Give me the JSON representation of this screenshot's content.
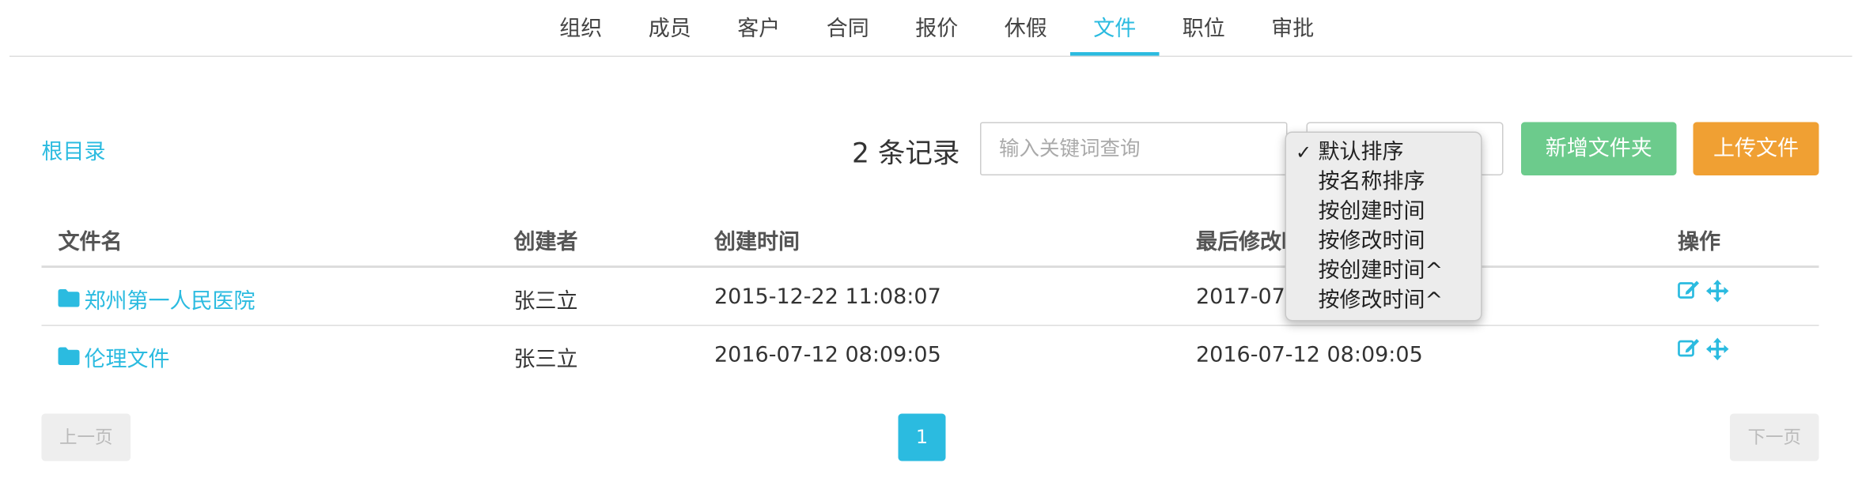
{
  "tabs": [
    {
      "label": "组织",
      "active": false
    },
    {
      "label": "成员",
      "active": false
    },
    {
      "label": "客户",
      "active": false
    },
    {
      "label": "合同",
      "active": false
    },
    {
      "label": "报价",
      "active": false
    },
    {
      "label": "休假",
      "active": false
    },
    {
      "label": "文件",
      "active": true
    },
    {
      "label": "职位",
      "active": false
    },
    {
      "label": "审批",
      "active": false
    }
  ],
  "breadcrumb": {
    "root_label": "根目录"
  },
  "records": {
    "count": "2",
    "suffix": "条记录"
  },
  "search": {
    "placeholder": "输入关键词查询",
    "value": ""
  },
  "sort": {
    "selected": "默认排序",
    "options": [
      "默认排序",
      "按名称排序",
      "按创建时间",
      "按修改时间",
      "按创建时间^",
      "按修改时间^"
    ],
    "check_glyph": "✓"
  },
  "buttons": {
    "new_folder": "新增文件夹",
    "upload": "上传文件"
  },
  "table": {
    "headers": [
      "文件名",
      "创建者",
      "创建时间",
      "最后修改时间",
      "操作"
    ],
    "rows": [
      {
        "name": "郑州第一人民医院",
        "creator": "张三立",
        "created": "2015-12-22 11:08:07",
        "modified": "2017-07-"
      },
      {
        "name": "伦理文件",
        "creator": "张三立",
        "created": "2016-07-12 08:09:05",
        "modified": "2016-07-12 08:09:05"
      }
    ]
  },
  "pagination": {
    "prev": "上一页",
    "next": "下一页",
    "current": "1"
  },
  "icons": {
    "row": [
      "folder-icon",
      "edit-icon",
      "move-icon"
    ],
    "check": "check-icon"
  },
  "colors": {
    "accent": "#2bbbe0",
    "green": "#6ccb8c",
    "orange": "#f0a033"
  }
}
